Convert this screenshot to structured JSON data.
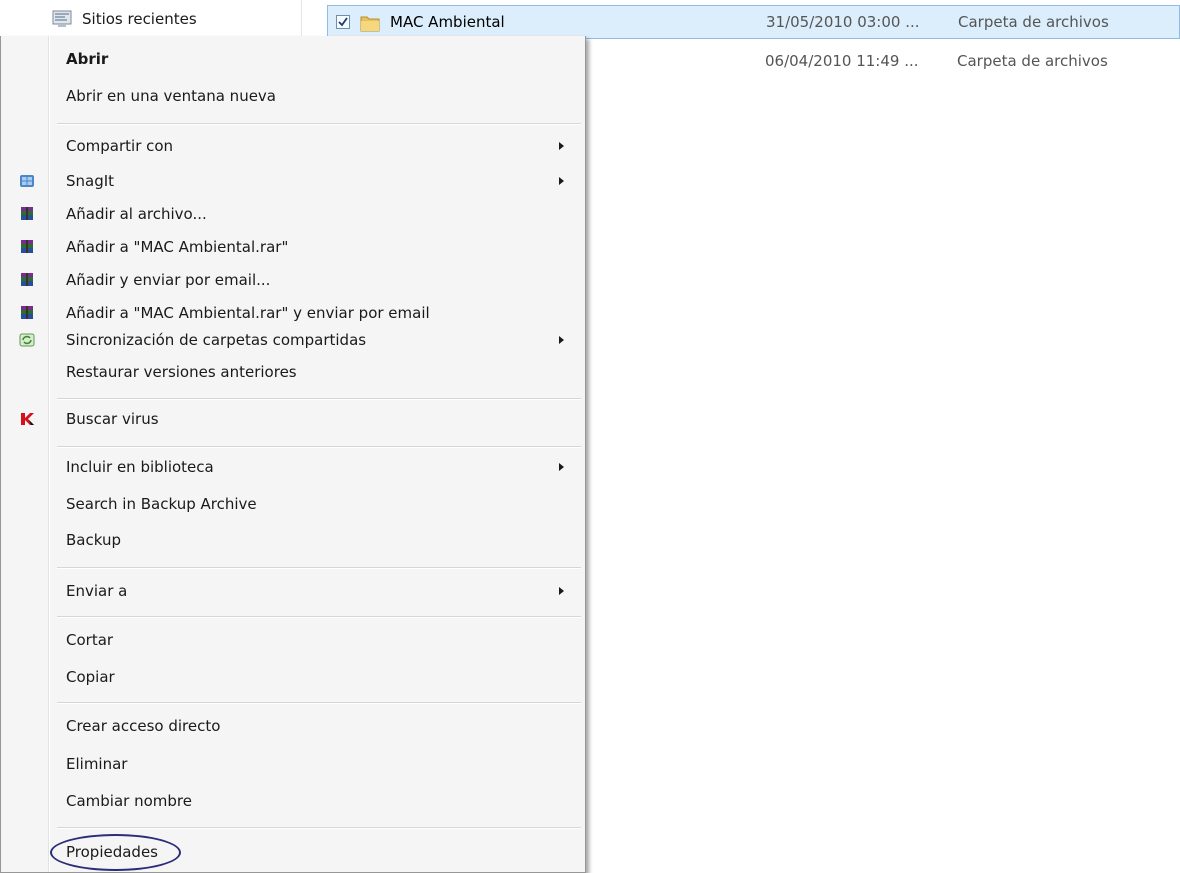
{
  "nav": {
    "sitios_label": "Sitios recientes",
    "sitios_icon": "recent-places-icon"
  },
  "files": [
    {
      "name": "MAC Ambiental",
      "date": "31/05/2010 03:00 ...",
      "type": "Carpeta de archivos",
      "checked": true,
      "selected": true
    },
    {
      "name": "",
      "date": "06/04/2010 11:49 ...",
      "type": "Carpeta de archivos",
      "checked": false,
      "selected": false
    }
  ],
  "context_menu": {
    "items": [
      {
        "label": "Abrir",
        "bold": true
      },
      {
        "label": "Abrir en una ventana nueva"
      },
      {
        "label": "Compartir con",
        "submenu": true
      },
      {
        "label": "SnagIt",
        "submenu": true,
        "icon": "snagit-icon"
      },
      {
        "label": "Añadir al archivo...",
        "icon": "winrar-icon"
      },
      {
        "label": "Añadir a \"MAC Ambiental.rar\"",
        "icon": "winrar-icon"
      },
      {
        "label": "Añadir y enviar por email...",
        "icon": "winrar-icon"
      },
      {
        "label": "Añadir a \"MAC Ambiental.rar\" y enviar por email",
        "icon": "winrar-icon"
      },
      {
        "label": "Sincronización de carpetas compartidas",
        "submenu": true,
        "icon": "sync-icon"
      },
      {
        "label": "Restaurar versiones anteriores"
      },
      {
        "label": "Buscar virus",
        "icon": "kaspersky-icon"
      },
      {
        "label": "Incluir en biblioteca",
        "submenu": true
      },
      {
        "label": "Search in Backup Archive"
      },
      {
        "label": "Backup"
      },
      {
        "label": "Enviar a",
        "submenu": true
      },
      {
        "label": "Cortar"
      },
      {
        "label": "Copiar"
      },
      {
        "label": "Crear acceso directo"
      },
      {
        "label": "Eliminar"
      },
      {
        "label": "Cambiar nombre"
      },
      {
        "label": "Propiedades",
        "highlighted": true
      }
    ]
  },
  "colors": {
    "selection_bg": "#dceefb",
    "selection_border": "#8fbce6",
    "ring": "#2a2d78",
    "menu_bg": "#f5f5f5"
  }
}
